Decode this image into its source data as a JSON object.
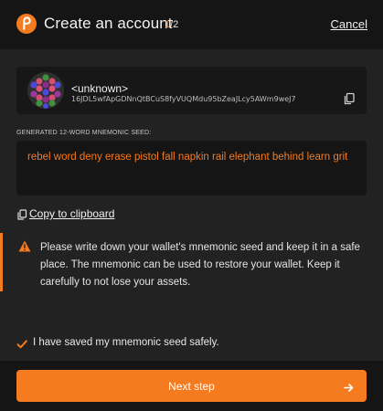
{
  "header": {
    "title": "Create an account",
    "step_current": "1",
    "step_total": "/2",
    "cancel_label": "Cancel"
  },
  "account": {
    "name": "<unknown>",
    "address": "16JDL5wfApGDNnQtBCuS8fyVUQMdu95bZeaJLcy5AWm9weJ7"
  },
  "seed": {
    "label": "GENERATED 12-WORD MNEMONIC SEED:",
    "phrase": "rebel word deny erase pistol fall napkin rail elephant behind learn grit",
    "copy_label": "Copy to clipboard"
  },
  "warning": {
    "text": "Please write down your wallet's mnemonic seed and keep it in a safe place. The mnemonic can be used to restore your wallet. Keep it carefully to not lose your assets."
  },
  "confirm": {
    "checked": true,
    "label": "I have saved my mnemonic seed safely."
  },
  "footer": {
    "next_label": "Next step"
  },
  "colors": {
    "accent": "#f47b20",
    "background": "#222222",
    "panel": "#151515"
  },
  "icons": {
    "logo": "polkadot-logo-icon",
    "copy": "copy-icon",
    "warning": "warning-triangle-icon",
    "check": "checkbox-checked-icon",
    "arrow": "arrow-right-icon"
  }
}
